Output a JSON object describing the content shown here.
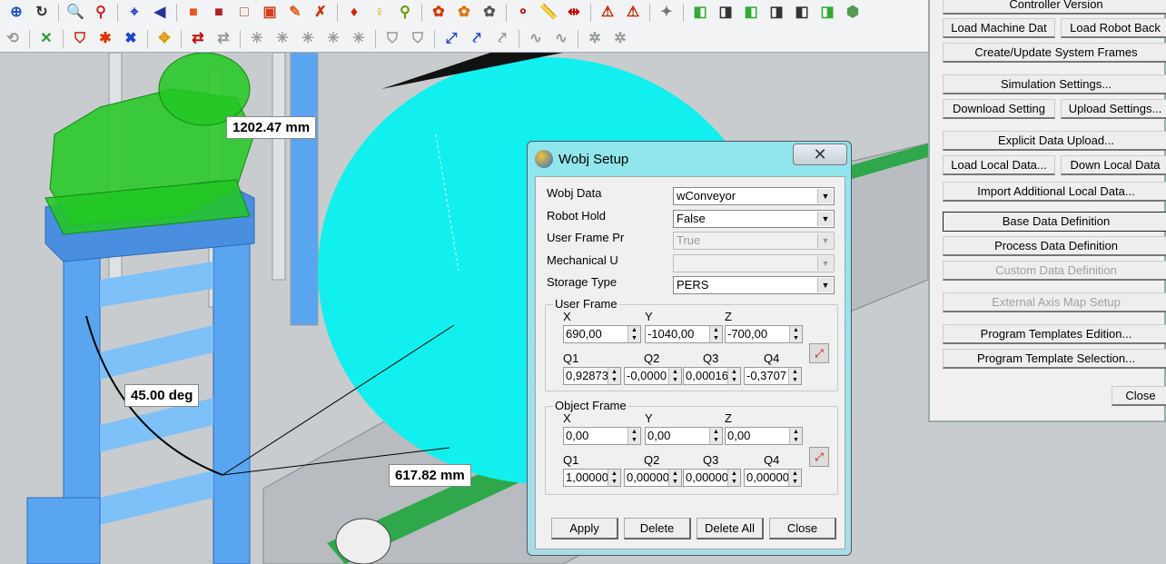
{
  "toolbar": {
    "row1": [
      {
        "icon": "zoom-fit-icon",
        "glyph": "⊕",
        "color": "#2255cc"
      },
      {
        "icon": "rotate-icon",
        "glyph": "↻",
        "color": "#333"
      },
      {
        "sep": true
      },
      {
        "icon": "zoom-icon",
        "glyph": "🔍",
        "color": "#2255cc"
      },
      {
        "icon": "zoom-red-icon",
        "glyph": "⚲",
        "color": "#cc2222"
      },
      {
        "sep": true
      },
      {
        "icon": "target-icon",
        "glyph": "⌖",
        "color": "#2233cc"
      },
      {
        "icon": "view-arrow-icon",
        "glyph": "◀",
        "color": "#223399"
      },
      {
        "sep": true
      },
      {
        "icon": "solid-view-icon",
        "glyph": "■",
        "color": "#e8541c"
      },
      {
        "icon": "shaded-view-icon",
        "glyph": "■",
        "color": "#b02020"
      },
      {
        "icon": "wireframe-view-icon",
        "glyph": "□",
        "color": "#d04020"
      },
      {
        "icon": "hidden-line-icon",
        "glyph": "▣",
        "color": "#d04020"
      },
      {
        "icon": "pen-icon",
        "glyph": "✎",
        "color": "#e06020"
      },
      {
        "icon": "axis-tool-icon",
        "glyph": "✗",
        "color": "#cc3300"
      },
      {
        "sep": true
      },
      {
        "icon": "light-red-icon",
        "glyph": "♦",
        "color": "#dd2200"
      },
      {
        "icon": "light-bulb-icon",
        "glyph": "♀",
        "color": "#ddaa00"
      },
      {
        "icon": "light-tool-icon",
        "glyph": "⚲",
        "color": "#669900"
      },
      {
        "sep": true
      },
      {
        "icon": "robot-joints-icon",
        "glyph": "✿",
        "color": "#dd3300"
      },
      {
        "icon": "robot-move-icon",
        "glyph": "✿",
        "color": "#e07000"
      },
      {
        "icon": "robot-frame-icon",
        "glyph": "✿",
        "color": "#555"
      },
      {
        "sep": true
      },
      {
        "icon": "path-icon",
        "glyph": "⚬",
        "color": "#cc0000"
      },
      {
        "icon": "measure-icon",
        "glyph": "📏",
        "color": "#ddbb00"
      },
      {
        "icon": "distance-icon",
        "glyph": "⇹",
        "color": "#cc0000"
      },
      {
        "sep": true
      },
      {
        "icon": "robot-arm-icon",
        "glyph": "⚠",
        "color": "#cc2200"
      },
      {
        "icon": "robot-arm-2-icon",
        "glyph": "⚠",
        "color": "#cc2200"
      },
      {
        "sep": true
      },
      {
        "icon": "settings-dropdown-icon",
        "glyph": "✦",
        "color": "#777"
      },
      {
        "sep": true
      },
      {
        "icon": "view-front-icon",
        "glyph": "◧",
        "color": "#33aa33"
      },
      {
        "icon": "view-back-icon",
        "glyph": "◨",
        "color": "#333"
      },
      {
        "icon": "view-left-icon",
        "glyph": "◧",
        "color": "#33aa33"
      },
      {
        "icon": "view-right-icon",
        "glyph": "◨",
        "color": "#333"
      },
      {
        "icon": "view-top-icon",
        "glyph": "◧",
        "color": "#333"
      },
      {
        "icon": "view-bottom-icon",
        "glyph": "◨",
        "color": "#33aa33"
      },
      {
        "icon": "view-iso-icon",
        "glyph": "⬢",
        "color": "#559955"
      }
    ],
    "row2": [
      {
        "icon": "undo-icon",
        "glyph": "⟲",
        "color": "#999"
      },
      {
        "sep": true
      },
      {
        "icon": "frame-icon",
        "glyph": "✕",
        "color": "#339933"
      },
      {
        "sep": true
      },
      {
        "icon": "shield-tool-icon",
        "glyph": "⛉",
        "color": "#cc2200"
      },
      {
        "icon": "point-icon",
        "glyph": "✱",
        "color": "#dd3300"
      },
      {
        "icon": "expand-icon",
        "glyph": "✖",
        "color": "#2244cc"
      },
      {
        "sep": true
      },
      {
        "icon": "move-icon",
        "glyph": "✥",
        "color": "#dd9900"
      },
      {
        "sep": true
      },
      {
        "icon": "collision-icon",
        "glyph": "⇄",
        "color": "#cc0000"
      },
      {
        "icon": "collision-off-icon",
        "glyph": "⇄",
        "color": "#999"
      },
      {
        "sep": true
      },
      {
        "icon": "tool-1-icon",
        "glyph": "✳",
        "color": "#999"
      },
      {
        "icon": "tool-2-icon",
        "glyph": "✳",
        "color": "#999"
      },
      {
        "icon": "tool-3-icon",
        "glyph": "✳",
        "color": "#999"
      },
      {
        "icon": "tool-4-icon",
        "glyph": "✳",
        "color": "#999"
      },
      {
        "icon": "tool-5-icon",
        "glyph": "✳",
        "color": "#999"
      },
      {
        "sep": true
      },
      {
        "icon": "tool-6-icon",
        "glyph": "⛉",
        "color": "#999"
      },
      {
        "icon": "tool-7-icon",
        "glyph": "⛉",
        "color": "#999"
      },
      {
        "sep": true
      },
      {
        "icon": "axes-icon",
        "glyph": "⤢",
        "color": "#2244cc"
      },
      {
        "icon": "axes-2-icon",
        "glyph": "⤤",
        "color": "#2244cc"
      },
      {
        "icon": "tool-8-icon",
        "glyph": "⤤",
        "color": "#999"
      },
      {
        "sep": true
      },
      {
        "icon": "curve-1-icon",
        "glyph": "∿",
        "color": "#999"
      },
      {
        "icon": "curve-2-icon",
        "glyph": "∿",
        "color": "#999"
      },
      {
        "sep": true
      },
      {
        "icon": "tool-9-icon",
        "glyph": "✲",
        "color": "#999"
      },
      {
        "icon": "tool-10-icon",
        "glyph": "✲",
        "color": "#999"
      }
    ]
  },
  "scene": {
    "labels": {
      "distance1": "1202.47 mm",
      "angle": "45.00 deg",
      "distance2": "617.82 mm"
    },
    "colors": {
      "robot": "#22c822",
      "tower": "#5aa5f0",
      "disc": "#11f0ee",
      "floor": "#c9ccce"
    }
  },
  "wobj_dialog": {
    "title": "Wobj Setup",
    "close_glyph": "✕",
    "fields": [
      {
        "label": "Wobj Data",
        "value": "wConveyor",
        "enabled": true
      },
      {
        "label": "Robot Hold",
        "value": "False",
        "enabled": true
      },
      {
        "label": "User  Frame Pr",
        "value": "True",
        "enabled": false
      },
      {
        "label": "Mechanical  U",
        "value": "",
        "enabled": false
      },
      {
        "label": "Storage Type",
        "value": "PERS",
        "enabled": true
      }
    ],
    "user_frame": {
      "title": "User Frame",
      "xyz_labels": [
        "X",
        "Y",
        "Z"
      ],
      "xyz": [
        "690,00",
        "-1040,00",
        "-700,00"
      ],
      "q_labels": [
        "Q1",
        "Q2",
        "Q3",
        "Q4"
      ],
      "q": [
        "0,92873",
        "-0,0000",
        "0,00016",
        "-0,3707"
      ]
    },
    "object_frame": {
      "title": "Object Frame",
      "xyz_labels": [
        "X",
        "Y",
        "Z"
      ],
      "xyz": [
        "0,00",
        "0,00",
        "0,00"
      ],
      "q_labels": [
        "Q1",
        "Q2",
        "Q3",
        "Q4"
      ],
      "q": [
        "1,00000",
        "0,00000",
        "0,00000",
        "0,00000"
      ]
    },
    "buttons": {
      "apply": "Apply",
      "delete": "Delete",
      "delete_all": "Delete All",
      "close": "Close"
    }
  },
  "side_panel": {
    "controller_version": "Controller Version",
    "load_machine": "Load  Machine Dat",
    "load_robot": "Load  Robot Back",
    "create_frames": "Create/Update System Frames",
    "sim_settings": "Simulation Settings...",
    "download_setting": "Download Setting",
    "upload_settings": "Upload Settings...",
    "explicit_upload": "Explicit Data Upload...",
    "load_local": "Load Local Data...",
    "down_local": "Down Local Data",
    "import_local": "Import Additional Local Data...",
    "base_data": "Base Data Definition",
    "process_data": "Process Data Definition",
    "custom_data": "Custom Data Definition",
    "ext_axis": "External Axis Map Setup",
    "templates_edition": "Program Templates Edition...",
    "template_selection": "Program Template Selection...",
    "close": "Close"
  }
}
